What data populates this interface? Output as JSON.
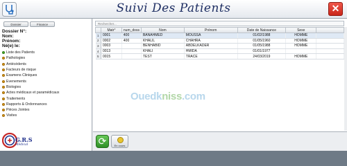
{
  "window": {
    "title": "Suivi Des Patients",
    "close_glyph": "✕"
  },
  "sidebar": {
    "tabs": [
      "Dossier",
      "Finance"
    ],
    "info_lines": [
      "Dossier N°:",
      "Nom:",
      "Prénom:",
      "Né(e) le:"
    ],
    "items": [
      {
        "label": "Liste des Patients",
        "active": true
      },
      {
        "label": "Pathologies"
      },
      {
        "label": "Antécédents"
      },
      {
        "label": "Facteurs de risque"
      },
      {
        "label": "Examens Cliniques"
      },
      {
        "label": "Evenements"
      },
      {
        "label": "Biologies"
      },
      {
        "label": "Actes médicaux  et paramédicaux"
      },
      {
        "label": "Traitements"
      },
      {
        "label": "Rapports & Ordonnances"
      },
      {
        "label": "Pièces Jointes"
      },
      {
        "label": "Visites"
      }
    ],
    "logo": {
      "text": "G.R.S",
      "sub": "Médical"
    }
  },
  "table": {
    "search_placeholder": "Rechercher...",
    "columns": [
      "Matr°",
      "num_doss",
      "Nom",
      "Prénom",
      "Date de Naissance",
      "Sexe"
    ],
    "rows": [
      {
        "rn": "1",
        "cells": [
          "0001",
          "400",
          "BANAHMED",
          "MOUSSA",
          "01/02/1988",
          "HOMME"
        ],
        "selected": true
      },
      {
        "rn": "2",
        "cells": [
          "0002",
          "400",
          "KHALIL",
          "CHAHRA",
          "01/05/1960",
          "HOMME"
        ]
      },
      {
        "rn": "3",
        "cells": [
          "0003",
          "",
          "BENHABID",
          "ABDELKADER",
          "01/05/1988",
          "HOMME"
        ]
      },
      {
        "rn": "4",
        "cells": [
          "0013",
          "",
          "KHALI",
          "HMIDA",
          "01/01/1977",
          ""
        ]
      },
      {
        "rn": "5",
        "cells": [
          "0015",
          "",
          "TEST",
          "TRACE",
          "24/03/2019",
          "HOMME"
        ]
      }
    ]
  },
  "watermark": {
    "part1": "Ouedk",
    "part2": "niss",
    "part3": ".com"
  },
  "footer": {
    "refresh_glyph": "⟳",
    "action_label": "En cours"
  },
  "colors": {
    "accent": "#1f2f63",
    "close": "#c9261a",
    "refresh": "#2f8f27"
  }
}
